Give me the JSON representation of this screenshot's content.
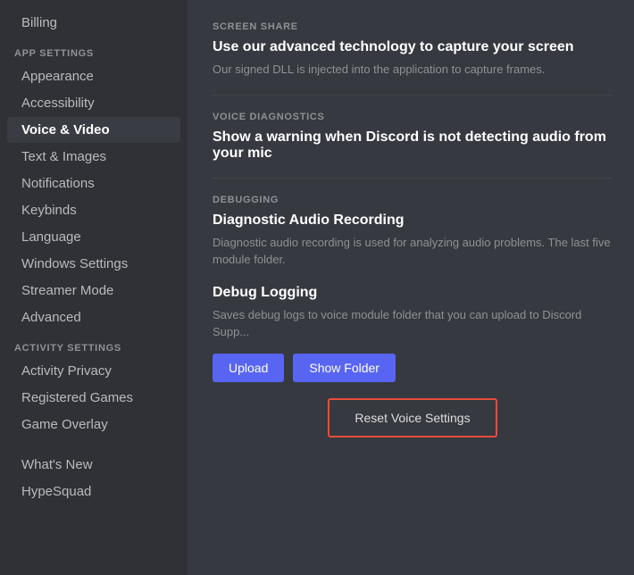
{
  "sidebar": {
    "billing_label": "Billing",
    "app_settings_section": "APP SETTINGS",
    "items": [
      {
        "id": "appearance",
        "label": "Appearance",
        "active": false
      },
      {
        "id": "accessibility",
        "label": "Accessibility",
        "active": false
      },
      {
        "id": "voice-video",
        "label": "Voice & Video",
        "active": true
      },
      {
        "id": "text-images",
        "label": "Text & Images",
        "active": false
      },
      {
        "id": "notifications",
        "label": "Notifications",
        "active": false
      },
      {
        "id": "keybinds",
        "label": "Keybinds",
        "active": false
      },
      {
        "id": "language",
        "label": "Language",
        "active": false
      },
      {
        "id": "windows-settings",
        "label": "Windows Settings",
        "active": false
      },
      {
        "id": "streamer-mode",
        "label": "Streamer Mode",
        "active": false
      },
      {
        "id": "advanced",
        "label": "Advanced",
        "active": false
      }
    ],
    "activity_settings_section": "ACTIVITY SETTINGS",
    "activity_items": [
      {
        "id": "activity-privacy",
        "label": "Activity Privacy"
      },
      {
        "id": "registered-games",
        "label": "Registered Games"
      },
      {
        "id": "game-overlay",
        "label": "Game Overlay"
      }
    ],
    "whats_new": "What's New",
    "hypesquad": "HypeSquad"
  },
  "main": {
    "screen_share": {
      "section_label": "SCREEN SHARE",
      "title": "Use our advanced technology to capture your screen",
      "description": "Our signed DLL is injected into the application to capture frames."
    },
    "voice_diagnostics": {
      "section_label": "VOICE DIAGNOSTICS",
      "title": "Show a warning when Discord is not detecting audio from your mic"
    },
    "debugging": {
      "section_label": "DEBUGGING",
      "diagnostic_title": "Diagnostic Audio Recording",
      "diagnostic_desc": "Diagnostic audio recording is used for analyzing audio problems. The last five module folder.",
      "debug_logging_title": "Debug Logging",
      "debug_logging_desc": "Saves debug logs to voice module folder that you can upload to Discord Supp...",
      "upload_label": "Upload",
      "show_folder_label": "Show Folder",
      "reset_label": "Reset Voice Settings"
    }
  }
}
